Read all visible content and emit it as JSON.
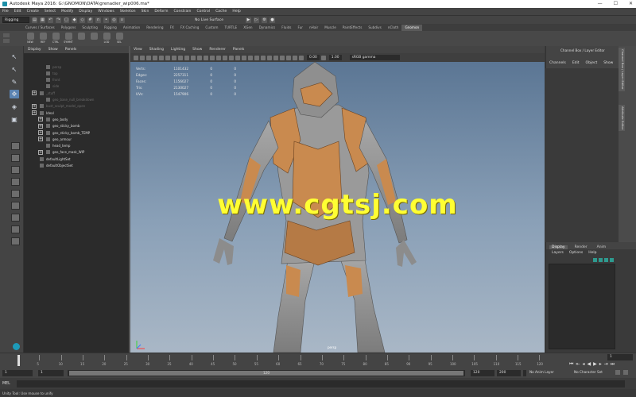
{
  "window": {
    "title": "Autodesk Maya 2016: G:\\GNOMON\\DATA\\grenadier_wip006.ma*"
  },
  "menubar": [
    "File",
    "Edit",
    "Create",
    "Select",
    "Modify",
    "Display",
    "Windows",
    "Skeleton",
    "Skin",
    "Deform",
    "Constrain",
    "Control",
    "Cache",
    "Help"
  ],
  "statusline": {
    "mode": "Rigging",
    "surface": "No Live Surface"
  },
  "shelf": {
    "tabs": [
      "Curves / Surfaces",
      "Polygons",
      "Sculpting",
      "Rigging",
      "Animation",
      "Rendering",
      "FX",
      "FX Caching",
      "Custom",
      "TURTLE",
      "XGen",
      "Dynamics",
      "Fluids",
      "Fur",
      "nHair",
      "Muscle",
      "PaintEffects",
      "Subdivs",
      "nCloth",
      "Gnomon"
    ],
    "active_tab": "Gnomon",
    "icons": [
      "NEW",
      "REF",
      "CTRL",
      "SYMMT",
      "",
      "",
      "LOD",
      "SEL"
    ]
  },
  "outliner": {
    "menu": [
      "Display",
      "Show",
      "Panels"
    ],
    "rows": [
      {
        "label": "persp",
        "dim": true,
        "indent": 1,
        "exp": false
      },
      {
        "label": "top",
        "dim": true,
        "indent": 1,
        "exp": false
      },
      {
        "label": "front",
        "dim": true,
        "indent": 1,
        "exp": false
      },
      {
        "label": "side",
        "dim": true,
        "indent": 1,
        "exp": false
      },
      {
        "label": "_stuff",
        "dim": true,
        "indent": 0,
        "exp": true
      },
      {
        "label": "geo_base_null_breakdown",
        "dim": true,
        "indent": 1,
        "exp": false
      },
      {
        "label": "bust_sculpt_model_open",
        "dim": true,
        "indent": 0,
        "exp": true
      },
      {
        "label": "Ideal",
        "dim": false,
        "indent": 0,
        "exp": true
      },
      {
        "label": "geo_body",
        "dim": false,
        "indent": 1,
        "exp": true
      },
      {
        "label": "geo_sticky_bomb",
        "dim": false,
        "indent": 1,
        "exp": true
      },
      {
        "label": "geo_sticky_bomb_TEMP",
        "dim": false,
        "indent": 1,
        "exp": true
      },
      {
        "label": "geo_armour",
        "dim": false,
        "indent": 1,
        "exp": true
      },
      {
        "label": "head_temp",
        "dim": false,
        "indent": 1,
        "exp": false
      },
      {
        "label": "geo_face_mask_WIP",
        "dim": false,
        "indent": 1,
        "exp": true
      },
      {
        "label": "defaultLightSet",
        "dim": false,
        "indent": 0,
        "exp": false
      },
      {
        "label": "defaultObjectSet",
        "dim": false,
        "indent": 0,
        "exp": false
      }
    ]
  },
  "viewport": {
    "menu": [
      "View",
      "Shading",
      "Lighting",
      "Show",
      "Renderer",
      "Panels"
    ],
    "exposure": "0.00",
    "gamma": "1.00",
    "colorspace": "sRGB gamma",
    "hud": [
      {
        "label": "Verts:",
        "value": "1101432",
        "a": "0",
        "b": "0"
      },
      {
        "label": "Edges:",
        "value": "2257311",
        "a": "0",
        "b": "0"
      },
      {
        "label": "Faces:",
        "value": "1156027",
        "a": "0",
        "b": "0"
      },
      {
        "label": "Tris:",
        "value": "2130027",
        "a": "0",
        "b": "0"
      },
      {
        "label": "UVs:",
        "value": "1547906",
        "a": "0",
        "b": "0"
      }
    ],
    "watermark": "www.cgtsj.com",
    "camera": "persp"
  },
  "channelbox": {
    "title": "Channel Box / Layer Editor",
    "menu": [
      "Channels",
      "Edit",
      "Object",
      "Show"
    ],
    "side_tabs": [
      "Channel Box / Layer Editor",
      "Attribute Editor"
    ]
  },
  "layers": {
    "tabs": [
      "Display",
      "Render",
      "Anim"
    ],
    "active_tab": "Display",
    "menu": [
      "Layers",
      "Options",
      "Help"
    ]
  },
  "timeline": {
    "ticks": [
      "5",
      "10",
      "15",
      "20",
      "25",
      "30",
      "35",
      "40",
      "45",
      "50",
      "55",
      "60",
      "65",
      "70",
      "75",
      "80",
      "85",
      "90",
      "95",
      "100",
      "105",
      "110",
      "115",
      "120"
    ],
    "current_frame": "1"
  },
  "range": {
    "start": "1",
    "inner_start": "1",
    "bar_label": "120",
    "inner_end": "120",
    "end": "200",
    "outer_end": "200",
    "anim_layer": "No Anim Layer",
    "char_set": "No Character Set"
  },
  "mel": {
    "label": "MEL"
  },
  "help": {
    "text": "Unity Tool: Use mouse to unify"
  }
}
